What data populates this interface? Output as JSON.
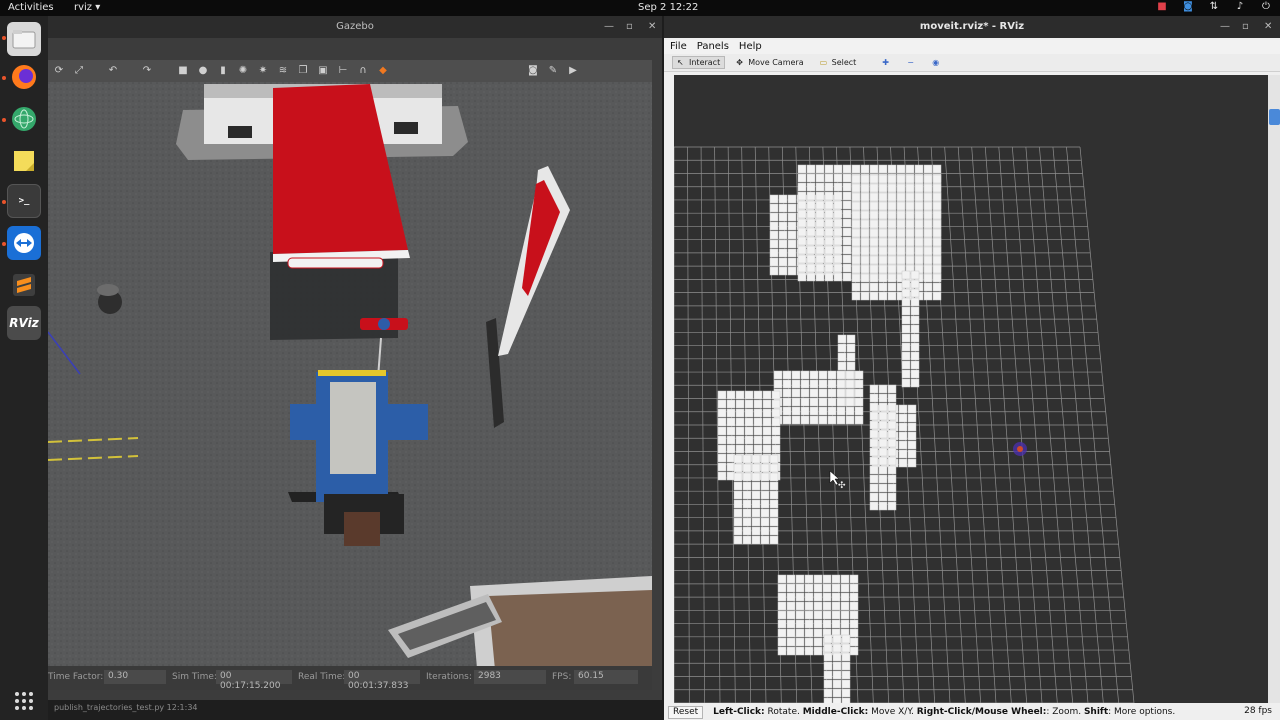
{
  "topbar": {
    "activities": "Activities",
    "app_menu": "rviz ▾",
    "clock": "Sep 2  12:22",
    "tray_icons": [
      "record-icon",
      "teamviewer-icon",
      "network-icon",
      "volume-icon",
      "power-icon"
    ]
  },
  "dock": {
    "apps": [
      "files-icon",
      "firefox-icon",
      "atom-icon",
      "notes-icon",
      "terminal-icon",
      "teamviewer-icon",
      "sublime-icon",
      "rviz-icon"
    ],
    "rviz_label": "RViz",
    "terminal_label": ">_"
  },
  "gazebo": {
    "title": "Gazebo",
    "status": {
      "time_factor_label": "Time Factor:",
      "time_factor": "0.30",
      "sim_time_label": "Sim Time:",
      "sim_time": "00 00:17:15.200",
      "real_time_label": "Real Time:",
      "real_time": "00 00:01:37.833",
      "iterations_label": "Iterations:",
      "iterations": "2983",
      "fps_label": "FPS:",
      "fps": "60.15"
    },
    "terminal_text": "publish_trajectories_test.py    12:1:34"
  },
  "rviz": {
    "title": "moveit.rviz* - RViz",
    "menu": [
      "File",
      "Panels",
      "Help"
    ],
    "tools": {
      "interact": "Interact",
      "move_camera": "Move Camera",
      "select": "Select"
    },
    "status": {
      "reset": "Reset",
      "hint_left_bold": "Left-Click:",
      "hint_left": " Rotate. ",
      "hint_middle_bold": "Middle-Click:",
      "hint_middle": " Move X/Y. ",
      "hint_right_bold": "Right-Click/Mouse Wheel:",
      "hint_right": ": Zoom. ",
      "hint_shift_bold": "Shift",
      "hint_shift": ": More options.",
      "fps": "28 fps"
    }
  },
  "colors": {
    "canopy_red": "#c8101b",
    "rviz_background": "#303030",
    "grid_line": "#8f8f8f",
    "voxel": "#f2f2f2"
  }
}
